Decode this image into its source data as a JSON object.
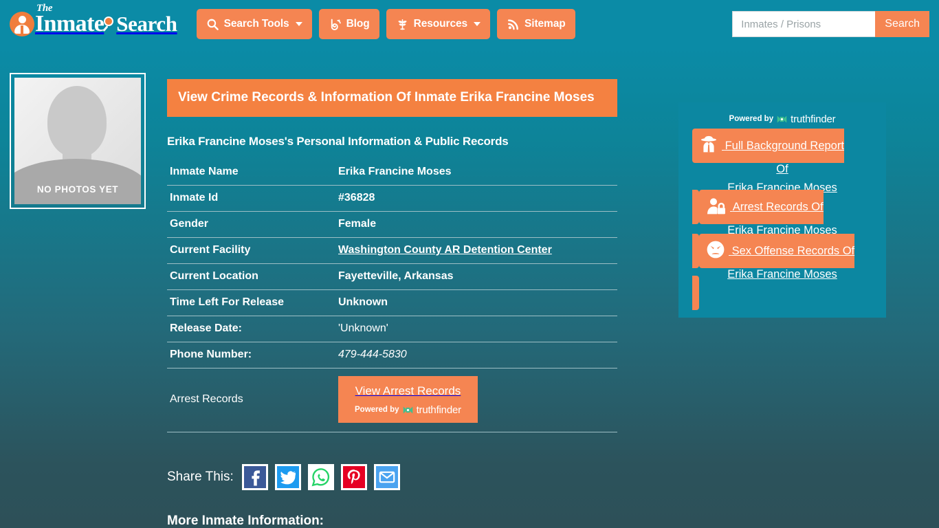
{
  "site": {
    "logo": {
      "the": "The",
      "inmate": "Inmate",
      "search": "Search",
      "badge_icon": "person-badge-icon",
      "magnifier_icon": "magnifier-icon"
    },
    "nav": [
      {
        "label": "Search Tools",
        "icon": "magnifier-icon",
        "has_caret": true
      },
      {
        "label": "Blog",
        "icon": "blogger-b-icon",
        "has_caret": false
      },
      {
        "label": "Resources",
        "icon": "leaf-icon",
        "has_caret": true
      },
      {
        "label": "Sitemap",
        "icon": "rss-feed-icon",
        "has_caret": false
      }
    ],
    "search": {
      "value": "",
      "placeholder": "Inmates / Prisons",
      "button_label": "Search"
    }
  },
  "mugshot": {
    "no_photo_label": "NO PHOTOS YET",
    "alt_name": "Erika Francine Moses"
  },
  "record": {
    "title": "View Crime Records & Information Of Inmate Erika Francine Moses",
    "subtitle": "Erika Francine Moses's Personal Information & Public Records",
    "rows": [
      {
        "label": "Inmate Name",
        "value": "Erika Francine Moses",
        "style": "bold"
      },
      {
        "label": "Inmate Id",
        "value": "#36828",
        "style": "bold"
      },
      {
        "label": "Gender",
        "value": "Female",
        "style": "bold"
      },
      {
        "label": "Current Facility",
        "value": "Washington County AR Detention Center",
        "style": "link"
      },
      {
        "label": "Current Location",
        "value": "Fayetteville, Arkansas",
        "style": "bold"
      },
      {
        "label": "Time Left For Release",
        "value": "Unknown",
        "style": "bold"
      },
      {
        "label": "Release Date:",
        "value": "'Unknown'",
        "style": "normal"
      },
      {
        "label": "Phone Number:",
        "value": "479-444-5830",
        "style": "italic"
      },
      {
        "label": "Arrest Records",
        "value": "",
        "style": "cta"
      }
    ],
    "arrest_cta": {
      "label": "View Arrest Records",
      "powered_by": "Powered by",
      "brand": "truthfinder"
    }
  },
  "share": {
    "label": "Share This:",
    "buttons": [
      {
        "name": "facebook",
        "color": "#3b5998",
        "glyph": "facebook-icon"
      },
      {
        "name": "twitter",
        "color": "#1d9bf0",
        "glyph": "twitter-bird-icon"
      },
      {
        "name": "whatsapp",
        "color": "#25d366",
        "glyph": "whatsapp-icon"
      },
      {
        "name": "pinterest",
        "color": "#e60023",
        "glyph": "pinterest-icon"
      },
      {
        "name": "email",
        "color": "#4aa3f0",
        "glyph": "envelope-icon"
      }
    ]
  },
  "more_info_heading": "More Inmate Information:",
  "sidebar": {
    "powered_by": "Powered by",
    "brand": "truthfinder",
    "cards": [
      {
        "icon": "detective-hat-icon",
        "line1": "Full Background Report",
        "line2": "Of",
        "line3": "Erika Francine Moses"
      },
      {
        "icon": "person-lock-icon",
        "line1": "Arrest Records Of",
        "line2": "Erika Francine Moses",
        "line3": ""
      },
      {
        "icon": "angry-face-icon",
        "line1": "Sex Offense Records Of",
        "line2": "Erika Francine Moses",
        "line3": ""
      }
    ]
  },
  "colors": {
    "accent_orange": "#f58552",
    "title_orange": "#f48141",
    "teal_top": "#0b8ba6",
    "teal_bottom": "#2d5058",
    "sidebar_teal": "#0c87a1",
    "truthfinder_green": "#3fbf8f"
  }
}
